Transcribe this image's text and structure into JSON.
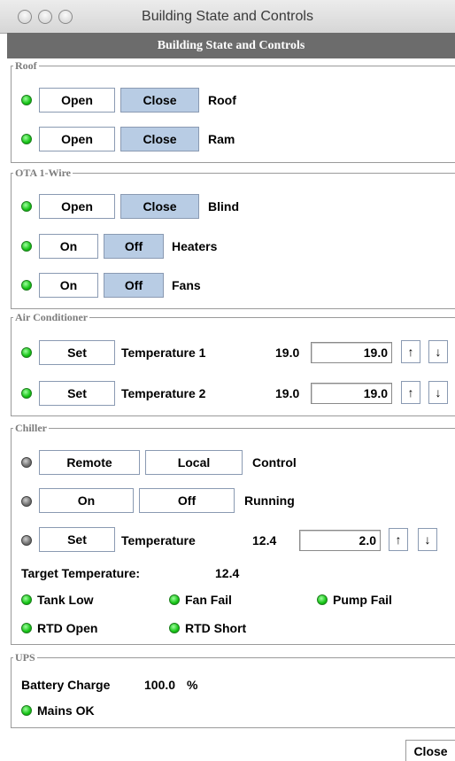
{
  "window": {
    "title": "Building State and Controls"
  },
  "header": {
    "title": "Building State and Controls"
  },
  "roof": {
    "legend": "Roof",
    "rows": [
      {
        "open": "Open",
        "close": "Close",
        "label": "Roof"
      },
      {
        "open": "Open",
        "close": "Close",
        "label": "Ram"
      }
    ]
  },
  "ota": {
    "legend": "OTA 1-Wire",
    "blind": {
      "open": "Open",
      "close": "Close",
      "label": "Blind"
    },
    "heaters": {
      "on": "On",
      "off": "Off",
      "label": "Heaters"
    },
    "fans": {
      "on": "On",
      "off": "Off",
      "label": "Fans"
    }
  },
  "air": {
    "legend": "Air Conditioner",
    "rows": [
      {
        "set": "Set",
        "label": "Temperature 1",
        "value": "19.0",
        "input": "19.0",
        "up": "↑",
        "down": "↓"
      },
      {
        "set": "Set",
        "label": "Temperature 2",
        "value": "19.0",
        "input": "19.0",
        "up": "↑",
        "down": "↓"
      }
    ]
  },
  "chiller": {
    "legend": "Chiller",
    "control": {
      "remote": "Remote",
      "local": "Local",
      "label": "Control"
    },
    "running": {
      "on": "On",
      "off": "Off",
      "label": "Running"
    },
    "temp": {
      "set": "Set",
      "label": "Temperature",
      "value": "12.4",
      "input": "2.0",
      "up": "↑",
      "down": "↓"
    },
    "target_label": "Target Temperature:",
    "target_value": "12.4",
    "statuses": [
      "Tank Low",
      "Fan Fail",
      "Pump Fail",
      "RTD Open",
      "RTD Short"
    ]
  },
  "ups": {
    "legend": "UPS",
    "battery_label": "Battery Charge",
    "battery_value": "100.0",
    "battery_unit": "%",
    "mains": "Mains OK"
  },
  "footer": {
    "close": "Close"
  },
  "colors": {
    "led_on": "#15c315",
    "led_off": "#707070",
    "button_active": "#b8cce4",
    "header_bg": "#6c6c6c"
  }
}
